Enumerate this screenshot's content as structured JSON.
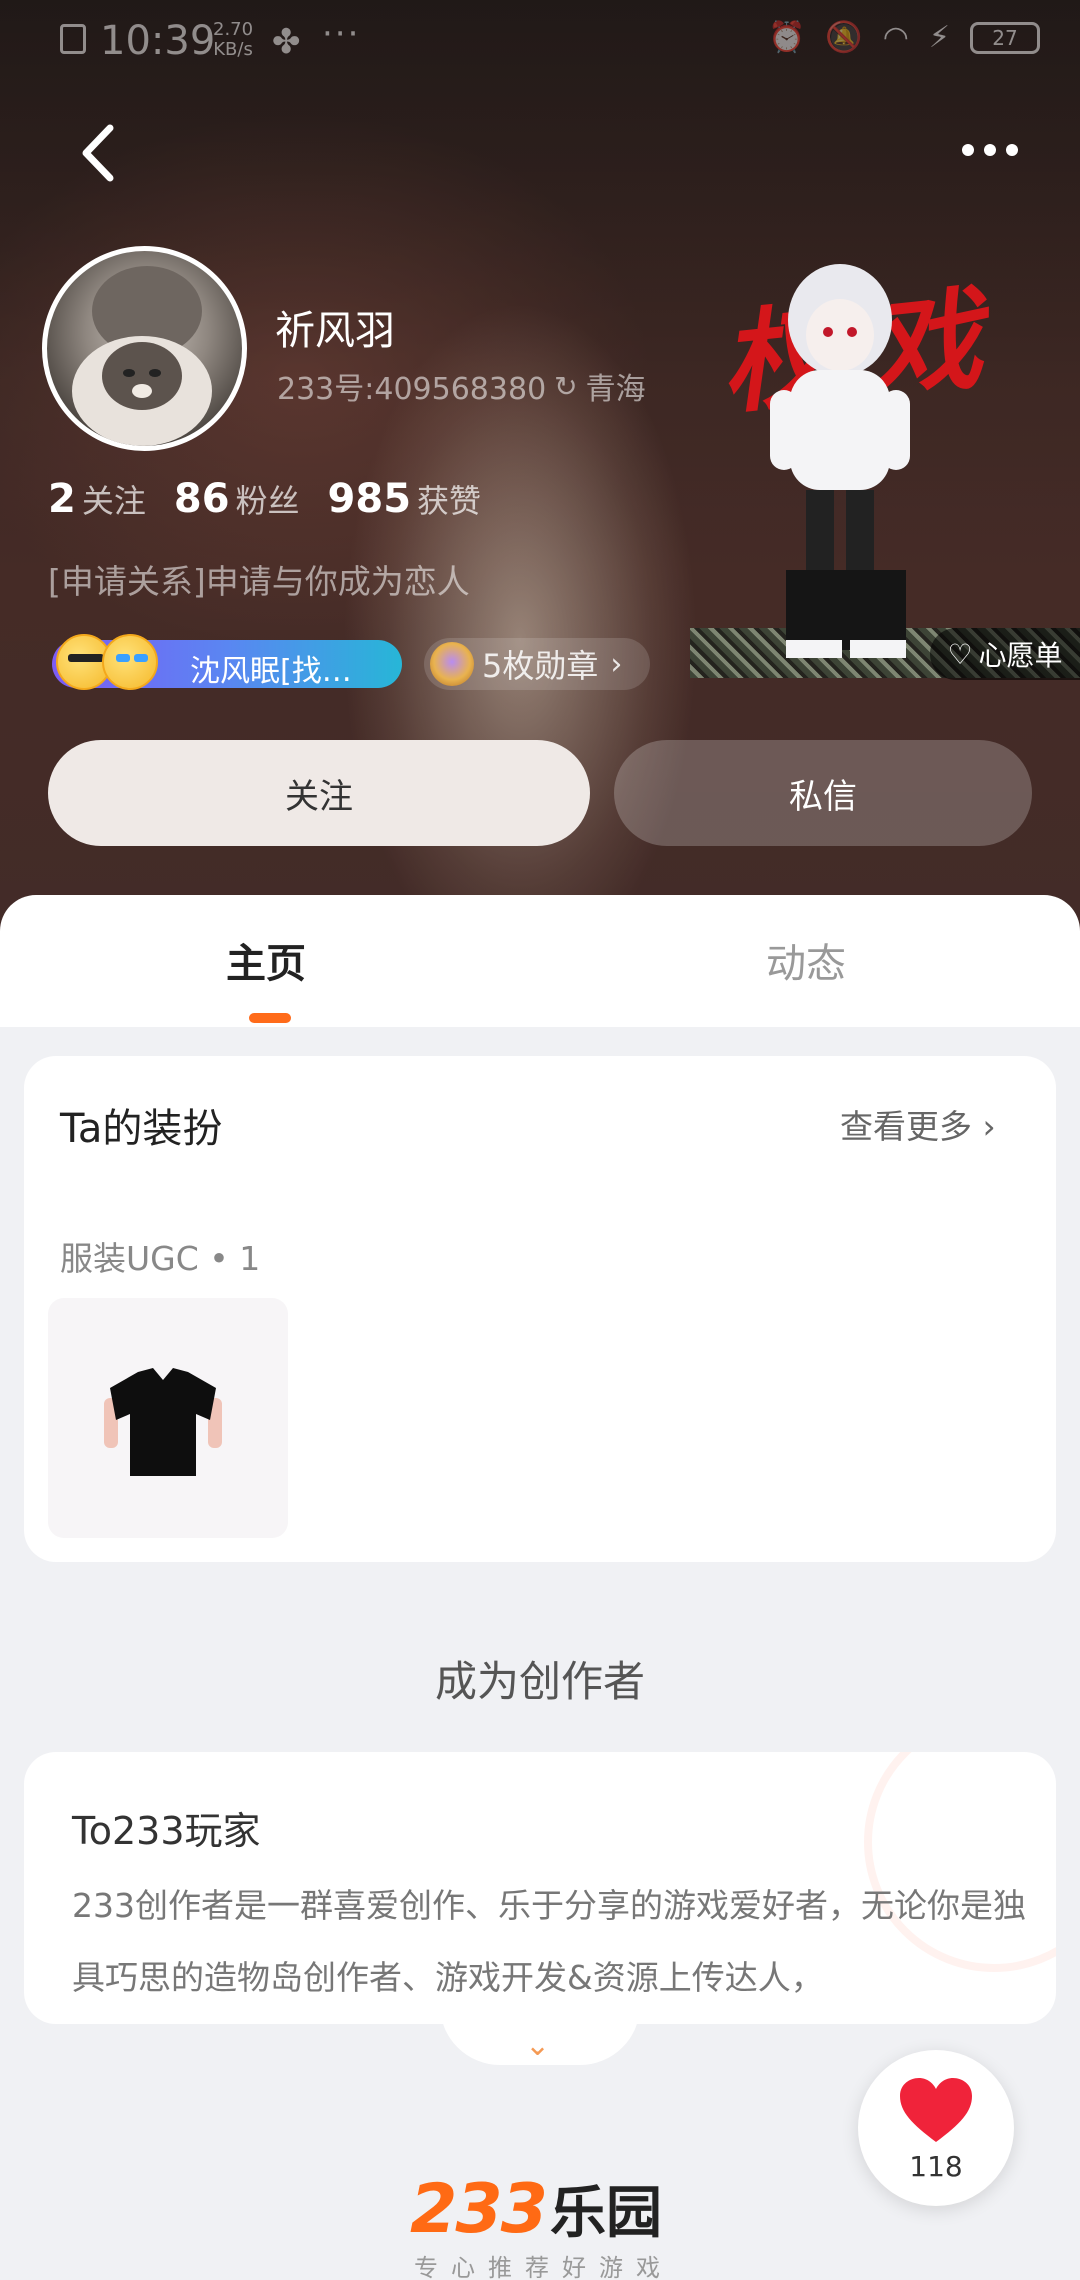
{
  "status_bar": {
    "time": "10:39",
    "speed_value": "2.70",
    "speed_unit": "KB/s",
    "battery": "27"
  },
  "profile": {
    "name": "祈风羽",
    "id_line": "233号:409568380",
    "location": "青海",
    "stats": [
      {
        "value": "2",
        "label": "关注"
      },
      {
        "value": "86",
        "label": "粉丝"
      },
      {
        "value": "985",
        "label": "获赞"
      }
    ],
    "bio": "[申请关系]申请与你成为恋人",
    "relation_chip": "沈风眠[找…",
    "medals": "5枚勋章",
    "wishlist": "心愿单",
    "character_text": "权戏"
  },
  "actions": {
    "follow": "关注",
    "message": "私信"
  },
  "tabs": {
    "home": "主页",
    "dynamic": "动态"
  },
  "dress": {
    "title": "Ta的装扮",
    "see_more": "查看更多",
    "ugc_label": "服装UGC • 1"
  },
  "creator": {
    "heading": "成为创作者",
    "card_title": "To233玩家",
    "card_text": "233创作者是一群喜爱创作、乐于分享的游戏爱好者，无论你是独具巧思的造物岛创作者、游戏开发&资源上传达人，"
  },
  "like": {
    "count": "118"
  },
  "logo": {
    "mark": "233",
    "name": "乐园",
    "slogan": "专心推荐好游戏"
  },
  "colors": {
    "accent": "#ff6b1a",
    "heart": "#f0233a"
  }
}
